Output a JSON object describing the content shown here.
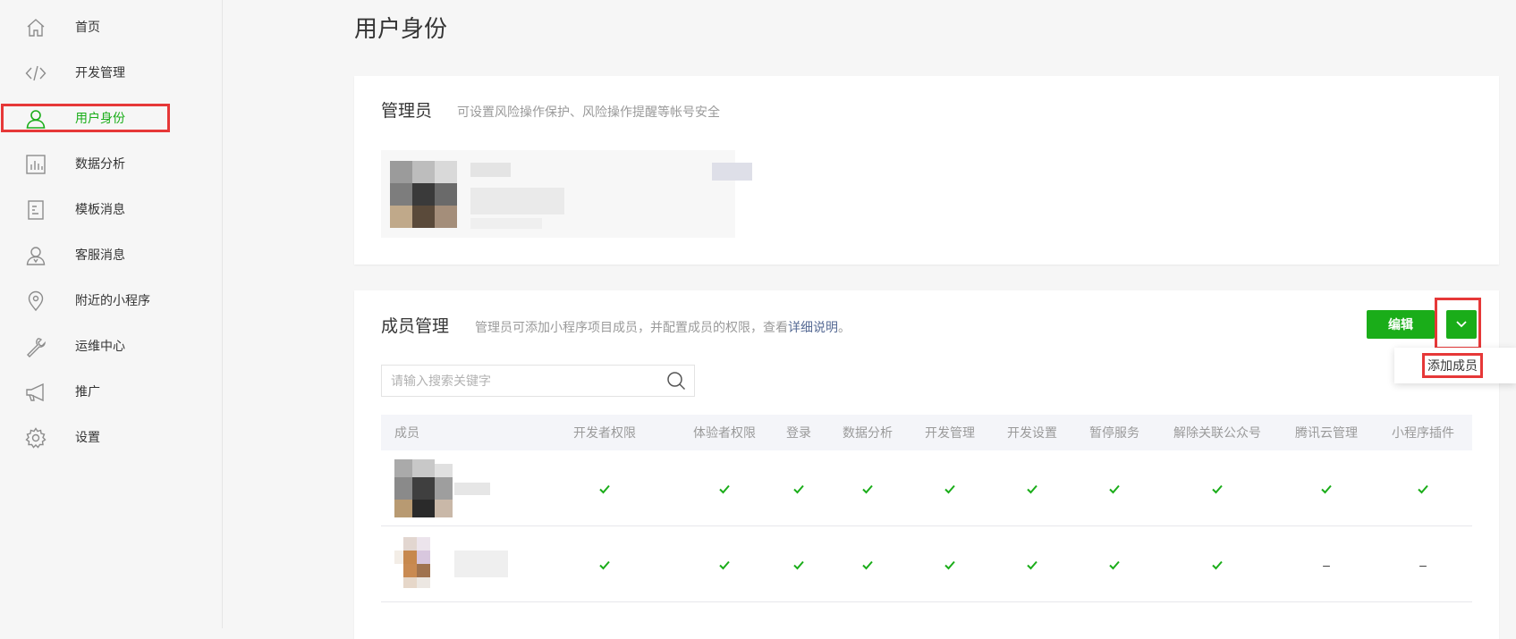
{
  "sidebar": {
    "items": [
      {
        "label": "首页",
        "icon": "home-icon"
      },
      {
        "label": "开发管理",
        "icon": "code-icon"
      },
      {
        "label": "用户身份",
        "icon": "user-icon",
        "active": true
      },
      {
        "label": "数据分析",
        "icon": "bar-chart-icon"
      },
      {
        "label": "模板消息",
        "icon": "document-icon"
      },
      {
        "label": "客服消息",
        "icon": "customer-service-icon"
      },
      {
        "label": "附近的小程序",
        "icon": "location-icon"
      },
      {
        "label": "运维中心",
        "icon": "wrench-icon"
      },
      {
        "label": "推广",
        "icon": "megaphone-icon"
      },
      {
        "label": "设置",
        "icon": "gear-icon"
      }
    ]
  },
  "page": {
    "title": "用户身份"
  },
  "admin": {
    "title": "管理员",
    "description": "可设置风险操作保护、风险操作提醒等帐号安全"
  },
  "members": {
    "title": "成员管理",
    "description": "管理员可添加小程序项目成员，并配置成员的权限，查看",
    "description_link": "详细说明",
    "description_end": "。",
    "edit_label": "编辑",
    "dropdown_item": "添加成员",
    "search_placeholder": "请输入搜索关键字",
    "columns": [
      "成员",
      "开发者权限",
      "体验者权限",
      "登录",
      "数据分析",
      "开发管理",
      "开发设置",
      "暂停服务",
      "解除关联公众号",
      "腾讯云管理",
      "小程序插件"
    ],
    "rows": [
      {
        "permissions": [
          "check",
          "check",
          "check",
          "check",
          "check",
          "check",
          "check",
          "check",
          "check",
          "check"
        ]
      },
      {
        "permissions": [
          "check",
          "check",
          "check",
          "check",
          "check",
          "check",
          "check",
          "check",
          "–",
          "–"
        ]
      }
    ]
  },
  "colors": {
    "accent": "#1aad19",
    "highlight": "#e63838",
    "link": "#576b95"
  }
}
